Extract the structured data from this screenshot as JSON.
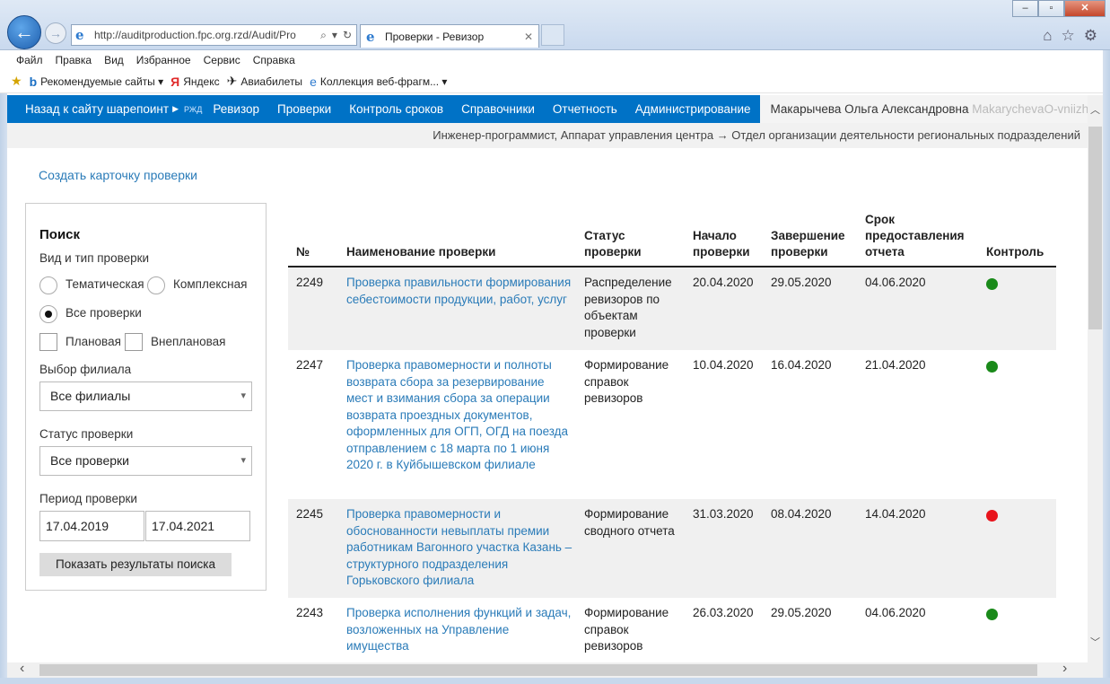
{
  "browser": {
    "address": "http://auditproduction.fpc.org.rzd/Audit/Pro",
    "tab_title": "Проверки - Ревизор",
    "menu": [
      "Файл",
      "Правка",
      "Вид",
      "Избранное",
      "Сервис",
      "Справка"
    ],
    "favorites": [
      "Рекомендуемые сайты ▾",
      "Яндекс",
      "Авиабилеты",
      "Коллекция веб-фрагм... ▾"
    ]
  },
  "appnav": {
    "back": "Назад к сайту шарепоинт",
    "logo": "РЖД",
    "items": [
      "Ревизор",
      "Проверки",
      "Контроль сроков",
      "Справочники",
      "Отчетность",
      "Администрирование"
    ],
    "user_name": "Макарычева Ольга Александровна",
    "user_login": "MakarychevaO-vniizht"
  },
  "subbar": "Инженер-программист, Аппарат управления центра → Отдел организации деятельности региональных подразделений",
  "create_link": "Создать карточку проверки",
  "search": {
    "title": "Поиск",
    "type_label": "Вид и тип проверки",
    "opt_thematic": "Тематическая",
    "opt_complex": "Комплексная",
    "opt_all": "Все проверки",
    "opt_planned": "Плановая",
    "opt_unplanned": "Внеплановая",
    "branch_label": "Выбор филиала",
    "branch_value": "Все филиалы",
    "status_label": "Статус проверки",
    "status_value": "Все проверки",
    "period_label": "Период проверки",
    "date_from": "17.04.2019",
    "date_to": "17.04.2021",
    "submit": "Показать результаты поиска"
  },
  "table": {
    "headers": {
      "num": "№",
      "name": "Наименование проверки",
      "status": "Статус проверки",
      "start": "Начало проверки",
      "end": "Завершение проверки",
      "due": "Срок предоставления отчета",
      "control": "Контроль"
    },
    "rows": [
      {
        "num": "2249",
        "name": "Проверка правильности формирования себестоимости продукции, работ, услуг",
        "status": "Распределение ревизоров по объектам проверки",
        "start": "20.04.2020",
        "end": "29.05.2020",
        "due": "04.06.2020",
        "control": "#1a8a1a"
      },
      {
        "num": "2247",
        "name": "Проверка правомерности и полноты возврата сбора за резервирование мест и взимания сбора за операции возврата проездных документов, оформленных для ОГП, ОГД на поезда отправлением с 18 марта по 1 июня 2020 г. в Куйбышевском филиале",
        "status": "Формирование справок ревизоров",
        "start": "10.04.2020",
        "end": "16.04.2020",
        "due": "21.04.2020",
        "control": "#1a8a1a"
      },
      {
        "num": "2245",
        "name": "Проверка правомерности и обоснованности невыплаты премии работникам Вагонного участка Казань – структурного подразделения Горьковского филиала",
        "status": "Формирование сводного отчета",
        "start": "31.03.2020",
        "end": "08.04.2020",
        "due": "14.04.2020",
        "control": "#e8141c"
      },
      {
        "num": "2243",
        "name": "Проверка исполнения функций и задач, возложенных на Управление имущества",
        "status": "Формирование справок ревизоров",
        "start": "26.03.2020",
        "end": "29.05.2020",
        "due": "04.06.2020",
        "control": "#1a8a1a"
      }
    ]
  }
}
